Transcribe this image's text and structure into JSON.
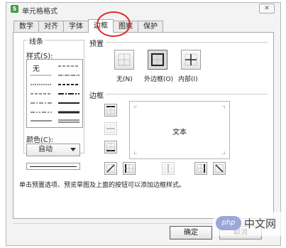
{
  "window": {
    "title": "单元格格式",
    "app_icon": "S",
    "close_label": "✕"
  },
  "tabs": [
    {
      "label": "数字",
      "active": false
    },
    {
      "label": "对齐",
      "active": false
    },
    {
      "label": "字体",
      "active": false
    },
    {
      "label": "边框",
      "active": true
    },
    {
      "label": "图案",
      "active": false
    },
    {
      "label": "保护",
      "active": false
    }
  ],
  "line_group": {
    "title": "线条",
    "style_label": "样式(S):",
    "none_label": "无",
    "color_label": "颜色(C):",
    "color_value": "自动"
  },
  "presets": {
    "heading": "预置",
    "items": [
      {
        "label": "无(N)",
        "icon": "border-none-icon"
      },
      {
        "label": "外边框(O)",
        "icon": "border-outline-icon"
      },
      {
        "label": "内部(I)",
        "icon": "border-inside-icon"
      }
    ]
  },
  "border": {
    "heading": "边框",
    "preview_text": "文本"
  },
  "hint": "单击预置选项、预览草图及上面的按钮可以添加边框样式。",
  "buttons": {
    "ok": "确定",
    "cancel": "取消"
  },
  "watermark": {
    "logo": "php",
    "text": "中文网"
  },
  "colors": {
    "highlight_circle": "#e02a2a",
    "app_icon": "#3f9b47"
  }
}
